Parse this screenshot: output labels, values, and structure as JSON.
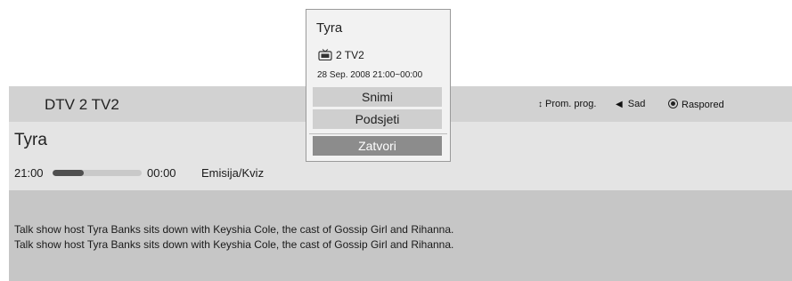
{
  "header": {
    "channel": "DTV 2  TV2",
    "hints": {
      "prog_label": "Prom. prog.",
      "sad_label": "Sad",
      "raspored_label": "Raspored"
    }
  },
  "program": {
    "title": "Tyra",
    "start_time": "21:00",
    "end_time": "00:00",
    "progress": 0.35,
    "genre": "Emisija/Kviz",
    "description": [
      "Talk show host Tyra Banks sits down with Keyshia Cole, the cast of Gossip Girl and Rihanna.",
      "Talk show host Tyra Banks sits down with Keyshia Cole, the cast of Gossip Girl and Rihanna."
    ]
  },
  "popup": {
    "title": "Tyra",
    "channel": "2 TV2",
    "datetime": "28 Sep. 2008 21:00~00:00",
    "buttons": {
      "record": "Snimi",
      "remind": "Podsjeti",
      "close": "Zatvori"
    }
  },
  "colors": {
    "header_bg": "#d2d2d2",
    "info_bg": "#e4e4e4",
    "desc_bg": "#c6c6c6",
    "close_button_bg": "#8c8c8c"
  }
}
